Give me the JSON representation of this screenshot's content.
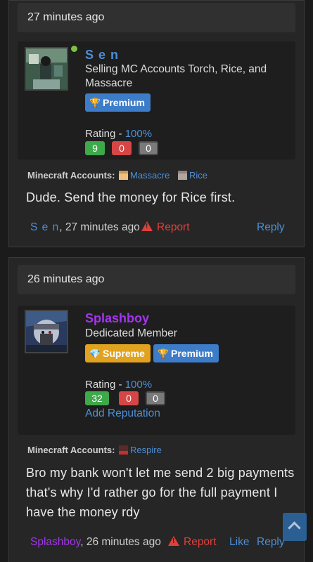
{
  "posts": [
    {
      "time": "27 minutes ago",
      "user": {
        "name": "S e n",
        "name_color": "#4d8fd6",
        "title": "Selling MC Accounts Torch, Rice, and Massacre",
        "online": true,
        "badges": [
          {
            "label": "Premium",
            "icon": "trophy-icon",
            "color": "#3d7cc8"
          }
        ],
        "rating_label": "Rating - ",
        "rating_pct": "100%",
        "rating_positive": "9",
        "rating_negative": "0",
        "rating_neutral": "0"
      },
      "mc_label": "Minecraft Accounts:",
      "mc_accounts": [
        "Massacre",
        "Rice"
      ],
      "message": "Dude. Send the money for Rice first.",
      "footer": {
        "author": "S e n",
        "time": ", 27 minutes ago",
        "report": "Report",
        "reply": "Reply"
      }
    },
    {
      "time": "26 minutes ago",
      "user": {
        "name": "Splashboy",
        "name_color": "#a335ee",
        "title": "Dedicated Member",
        "online": false,
        "badges": [
          {
            "label": "Supreme",
            "icon": "diamond-icon",
            "color": "#e1a220"
          },
          {
            "label": "Premium",
            "icon": "trophy-icon",
            "color": "#3d7cc8"
          }
        ],
        "rating_label": "Rating - ",
        "rating_pct": "100%",
        "rating_positive": "32",
        "rating_negative": "0",
        "rating_neutral": "0",
        "add_reputation": "Add Reputation"
      },
      "mc_label": "Minecraft Accounts:",
      "mc_accounts": [
        "Respire"
      ],
      "message": "Bro my bank won't let me send 2 big payments that's why I'd rather go for the full payment I have the money rdy",
      "footer": {
        "author": "Splashboy",
        "time": ", 26 minutes ago",
        "report": "Report",
        "like": "Like",
        "reply": "Reply"
      }
    }
  ]
}
